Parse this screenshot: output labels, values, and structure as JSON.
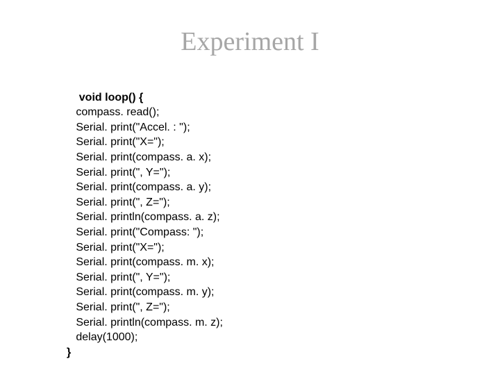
{
  "title": "Experiment I",
  "code": {
    "sig_open": "void loop() {",
    "lines": [
      "compass. read();",
      "Serial. print(\"Accel. : \");",
      "Serial. print(\"X=\");",
      "Serial. print(compass. a. x);",
      "Serial. print(\", Y=\");",
      "Serial. print(compass. a. y);",
      "Serial. print(\", Z=\");",
      "Serial. println(compass. a. z);",
      "Serial. print(\"Compass: \");",
      "Serial. print(\"X=\");",
      "Serial. print(compass. m. x);",
      "Serial. print(\", Y=\");",
      "Serial. print(compass. m. y);",
      "Serial. print(\", Z=\");",
      "Serial. println(compass. m. z);",
      "delay(1000);"
    ],
    "sig_close": "}"
  }
}
